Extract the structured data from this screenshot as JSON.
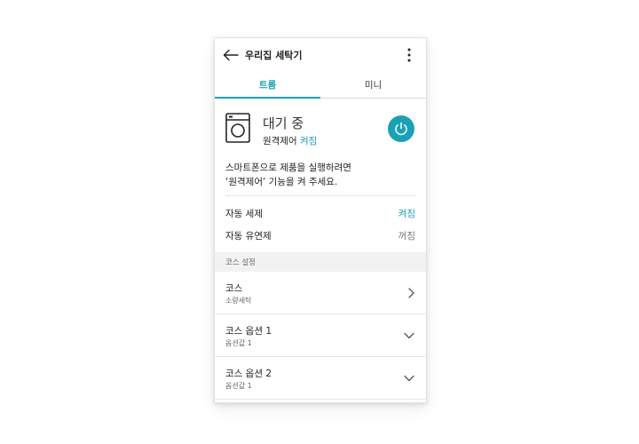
{
  "header": {
    "title": "우리집 세탁기"
  },
  "tabs": [
    {
      "label": "트롬",
      "active": true
    },
    {
      "label": "미니",
      "active": false
    }
  ],
  "status": {
    "state": "대기 중",
    "remote_label": "원격제어",
    "remote_value": "켜짐"
  },
  "description": {
    "line1": "스마트폰으로 제품을 실행하려면",
    "line2": "‘원격제어’ 기능을 켜 주세요."
  },
  "options": [
    {
      "label": "자동 세제",
      "value": "켜짐"
    },
    {
      "label": "자동 유연제",
      "value": "꺼짐"
    }
  ],
  "section": {
    "title": "코스 설정"
  },
  "course_items": [
    {
      "title": "코스",
      "subtitle": "소량세탁"
    },
    {
      "title": "코스 옵션 1",
      "subtitle": "옵션값 1"
    },
    {
      "title": "코스 옵션 2",
      "subtitle": "옵션값 1"
    }
  ],
  "colors": {
    "accent": "#1ca0b4",
    "section_bg": "#f2f2f2"
  },
  "icons": {
    "back": "arrow-left-icon",
    "more": "more-vertical-icon",
    "washer": "washing-machine-icon",
    "power": "power-icon",
    "chevron_right": "chevron-right-icon",
    "chevron_down": "chevron-down-icon"
  }
}
